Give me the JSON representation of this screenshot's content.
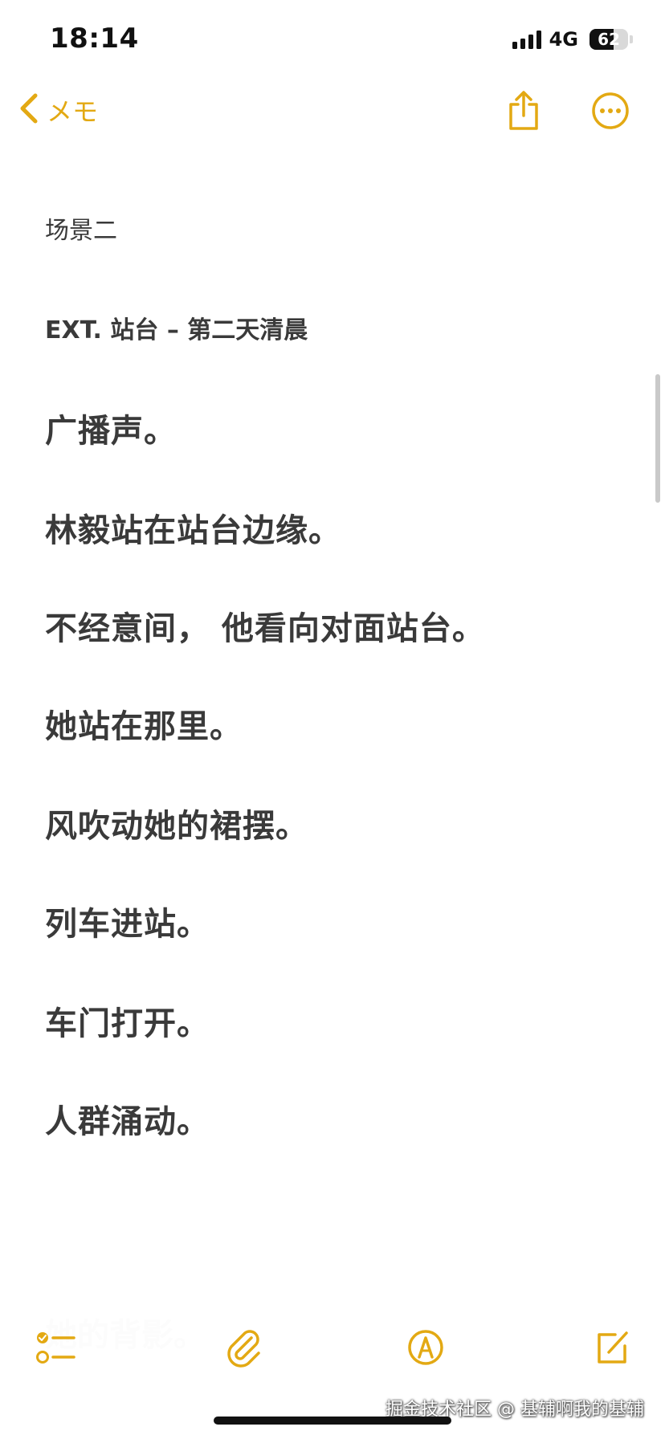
{
  "status_bar": {
    "time": "18:14",
    "network": "4G",
    "battery_percent": "62",
    "battery_level": 0.62
  },
  "nav": {
    "back_label": "メモ",
    "icons": {
      "back": "chevron-left-icon",
      "share": "share-icon",
      "more": "ellipsis-circle-icon"
    }
  },
  "note": {
    "scene_title": "场景二",
    "scene_heading": "EXT. 站台 – 第二天清晨",
    "lines": [
      "广播声。",
      "林毅站在站台边缘。",
      "不经意间， 他看向对面站台。",
      "她站在那里。",
      "风吹动她的裙摆。",
      "列车进站。",
      "车门打开。",
      "人群涌动。"
    ],
    "faded_line": "她的背影。"
  },
  "toolbar": {
    "icons": {
      "checklist": "checklist-icon",
      "attach": "paperclip-icon",
      "markup": "pen-circle-icon",
      "compose": "compose-icon"
    }
  },
  "watermark": "掘金技术社区 @ 基辅啊我的基辅",
  "colors": {
    "accent": "#e3a913",
    "text": "#3a3a3a",
    "background": "#ffffff"
  }
}
